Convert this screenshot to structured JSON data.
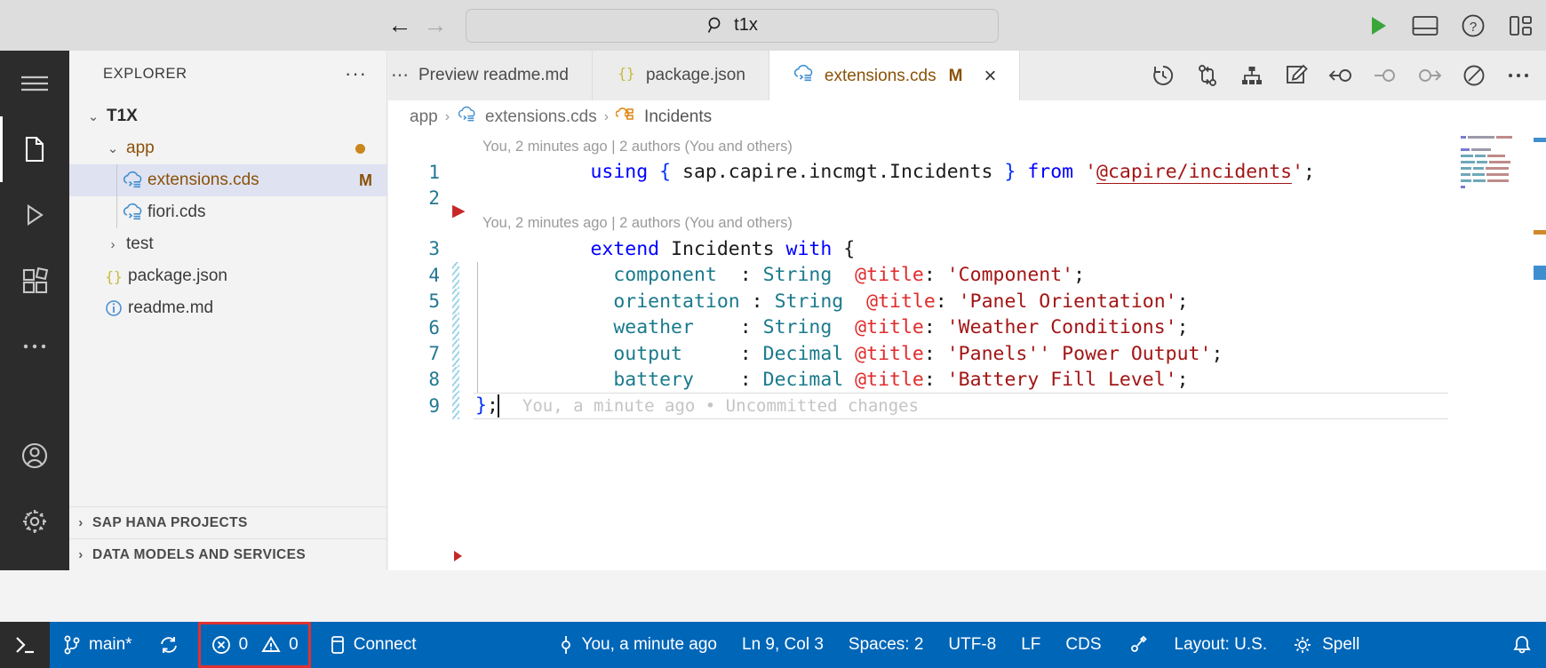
{
  "titlebar": {
    "back_icon": "arrow-left-icon",
    "forward_icon": "arrow-right-icon",
    "search_value": "t1x",
    "search_icon": "search-icon",
    "actions": [
      {
        "name": "run-project-button",
        "icon": "play-icon",
        "color": "#3aa63a"
      },
      {
        "name": "toggle-panel-button",
        "icon": "panel-layout-icon"
      },
      {
        "name": "help-button",
        "icon": "question-circle-icon"
      },
      {
        "name": "customize-layout-button",
        "icon": "customize-layout-icon"
      }
    ]
  },
  "activitybar": {
    "items": [
      {
        "name": "menu-button",
        "icon": "hamburger-icon",
        "active": false
      },
      {
        "name": "explorer-button",
        "icon": "files-icon",
        "active": true
      },
      {
        "name": "run-debug-button",
        "icon": "run-debug-icon",
        "active": false
      },
      {
        "name": "extensions-button",
        "icon": "extensions-icon",
        "active": false
      },
      {
        "name": "more-views-button",
        "icon": "ellipsis-icon",
        "active": false
      },
      {
        "name": "accounts-button",
        "icon": "account-icon",
        "active": false
      },
      {
        "name": "settings-button",
        "icon": "gear-icon",
        "active": false
      }
    ]
  },
  "sidebar": {
    "title": "EXPLORER",
    "more_actions": "···",
    "tree": [
      {
        "name": "tree-item-t1x",
        "label": "T1X",
        "chevron": "⌄",
        "expanded": true,
        "depth": 0,
        "style": "bold",
        "icon": "",
        "badge": ""
      },
      {
        "name": "tree-item-app",
        "label": "app",
        "chevron": "⌄",
        "expanded": true,
        "depth": 1,
        "style": "mod",
        "icon": "",
        "badge": "dot"
      },
      {
        "name": "tree-item-extensions-cds",
        "label": "extensions.cds",
        "chevron": "",
        "expanded": false,
        "depth": 2,
        "style": "mod",
        "icon": "cds-icon",
        "badge": "M",
        "selected": true
      },
      {
        "name": "tree-item-fiori-cds",
        "label": "fiori.cds",
        "chevron": "",
        "expanded": false,
        "depth": 2,
        "style": "",
        "icon": "cds-icon",
        "badge": ""
      },
      {
        "name": "tree-item-test",
        "label": "test",
        "chevron": "›",
        "expanded": false,
        "depth": 1,
        "style": "",
        "icon": "",
        "badge": ""
      },
      {
        "name": "tree-item-package-json",
        "label": "package.json",
        "chevron": "",
        "expanded": false,
        "depth": 1,
        "style": "",
        "icon": "json-icon",
        "badge": ""
      },
      {
        "name": "tree-item-readme-md",
        "label": "readme.md",
        "chevron": "",
        "expanded": false,
        "depth": 1,
        "style": "",
        "icon": "info-icon",
        "badge": ""
      }
    ],
    "sections": [
      {
        "name": "sidebar-section-sap-hana-projects",
        "label": "SAP HANA PROJECTS",
        "chevron": "›"
      },
      {
        "name": "sidebar-section-data-models-and-services",
        "label": "DATA MODELS AND SERVICES",
        "chevron": "›"
      }
    ]
  },
  "editor": {
    "tabs": [
      {
        "name": "tab-preview-readme-md",
        "label": "Preview readme.md",
        "icon": "",
        "modified": "",
        "active": false,
        "clipped": true
      },
      {
        "name": "tab-package-json",
        "label": "package.json",
        "icon": "json-icon",
        "modified": "",
        "active": false
      },
      {
        "name": "tab-extensions-cds",
        "label": "extensions.cds",
        "icon": "cds-icon",
        "modified": "M",
        "active": true,
        "close": "×"
      }
    ],
    "tab_actions": [
      {
        "name": "timeline-history-button",
        "icon": "history-clock-icon"
      },
      {
        "name": "git-compare-button",
        "icon": "git-compare-icon"
      },
      {
        "name": "graph-hierarchy-button",
        "icon": "hierarchy-icon"
      },
      {
        "name": "edit-note-button",
        "icon": "edit-note-icon"
      },
      {
        "name": "go-to-previous-button",
        "icon": "arrow-circle-left-icon"
      },
      {
        "name": "circle-node-button",
        "icon": "circle-node-icon"
      },
      {
        "name": "go-to-next-button",
        "icon": "arrow-circle-right-icon"
      },
      {
        "name": "preview-graph-button",
        "icon": "pie-graph-icon"
      },
      {
        "name": "more-actions-button",
        "icon": "ellipsis-icon"
      }
    ],
    "breadcrumb": [
      {
        "name": "breadcrumb-app",
        "label": "app",
        "icon": ""
      },
      {
        "name": "breadcrumb-extensions-cds",
        "label": "extensions.cds",
        "icon": "cds-icon"
      },
      {
        "name": "breadcrumb-incidents",
        "label": "Incidents",
        "icon": "entity-icon"
      }
    ],
    "breadcrumb_separator": "›",
    "blame_top": "You, 2 minutes ago | 2 authors (You and others)",
    "blame_mid": "You, 2 minutes ago | 2 authors (You and others)",
    "inline_blame": "You, a minute ago • Uncommitted changes",
    "lines": [
      {
        "num": "1",
        "tokens": [
          {
            "t": "using ",
            "c": "t-kw"
          },
          {
            "t": "{ ",
            "c": "t-brace"
          },
          {
            "t": "sap.capire.incmgt.Incidents",
            "c": "t-ident"
          },
          {
            "t": " }",
            "c": "t-brace"
          },
          {
            "t": " from ",
            "c": "t-kw"
          },
          {
            "t": "'",
            "c": "t-str"
          },
          {
            "t": "@capire/incidents",
            "c": "t-link"
          },
          {
            "t": "'",
            "c": "t-str"
          },
          {
            "t": ";",
            "c": "t-punc"
          }
        ],
        "diff": false
      },
      {
        "num": "2",
        "tokens": [],
        "diff": false
      },
      {
        "num": "3",
        "tokens": [
          {
            "t": "extend ",
            "c": "t-kw"
          },
          {
            "t": "Incidents",
            "c": "t-ident"
          },
          {
            "t": " with ",
            "c": "t-kw"
          },
          {
            "t": "{",
            "c": "t-punc"
          }
        ],
        "diff": false
      },
      {
        "num": "4",
        "tokens": [
          {
            "t": "  component  ",
            "c": "t-prop"
          },
          {
            "t": ": ",
            "c": "t-punc"
          },
          {
            "t": "String ",
            "c": "t-type"
          },
          {
            "t": " @title",
            "c": "t-anno"
          },
          {
            "t": ": ",
            "c": "t-punc"
          },
          {
            "t": "'Component'",
            "c": "t-str"
          },
          {
            "t": ";",
            "c": "t-punc"
          }
        ],
        "diff": true
      },
      {
        "num": "5",
        "tokens": [
          {
            "t": "  orientation",
            "c": "t-prop"
          },
          {
            "t": " : ",
            "c": "t-punc"
          },
          {
            "t": "String ",
            "c": "t-type"
          },
          {
            "t": " @title",
            "c": "t-anno"
          },
          {
            "t": ": ",
            "c": "t-punc"
          },
          {
            "t": "'Panel Orientation'",
            "c": "t-str"
          },
          {
            "t": ";",
            "c": "t-punc"
          }
        ],
        "diff": true
      },
      {
        "num": "6",
        "tokens": [
          {
            "t": "  weather    ",
            "c": "t-prop"
          },
          {
            "t": ": ",
            "c": "t-punc"
          },
          {
            "t": "String ",
            "c": "t-type"
          },
          {
            "t": " @title",
            "c": "t-anno"
          },
          {
            "t": ": ",
            "c": "t-punc"
          },
          {
            "t": "'Weather Conditions'",
            "c": "t-str"
          },
          {
            "t": ";",
            "c": "t-punc"
          }
        ],
        "diff": true
      },
      {
        "num": "7",
        "tokens": [
          {
            "t": "  output     ",
            "c": "t-prop"
          },
          {
            "t": ": ",
            "c": "t-punc"
          },
          {
            "t": "Decimal",
            "c": "t-type"
          },
          {
            "t": " @title",
            "c": "t-anno"
          },
          {
            "t": ": ",
            "c": "t-punc"
          },
          {
            "t": "'Panels'' Power Output'",
            "c": "t-str"
          },
          {
            "t": ";",
            "c": "t-punc"
          }
        ],
        "diff": true
      },
      {
        "num": "8",
        "tokens": [
          {
            "t": "  battery    ",
            "c": "t-prop"
          },
          {
            "t": ": ",
            "c": "t-punc"
          },
          {
            "t": "Decimal",
            "c": "t-type"
          },
          {
            "t": " @title",
            "c": "t-anno"
          },
          {
            "t": ": ",
            "c": "t-punc"
          },
          {
            "t": "'Battery Fill Level'",
            "c": "t-str"
          },
          {
            "t": ";",
            "c": "t-punc"
          }
        ],
        "diff": true
      },
      {
        "num": "9",
        "tokens": [
          {
            "t": "}",
            "c": "t-brace"
          },
          {
            "t": ";",
            "c": "t-punc"
          }
        ],
        "diff": true,
        "current": true
      }
    ]
  },
  "statusbar": {
    "remote_icon": "remote-window-icon",
    "branch": "main*",
    "branch_icon": "source-control-icon",
    "sync_icon": "sync-icon",
    "errors": "0",
    "warnings": "0",
    "error_icon": "error-circle-icon",
    "warning_icon": "warning-triangle-icon",
    "connect_label": "Connect",
    "connect_icon": "database-icon",
    "blame_label": "You, a minute ago",
    "blame_icon": "git-commit-icon",
    "position": "Ln 9, Col 3",
    "indentation": "Spaces: 2",
    "encoding": "UTF-8",
    "eol": "LF",
    "language": "CDS",
    "screencast_icon": "screencast-icon",
    "keyboard_layout": "Layout: U.S.",
    "spell_label": "Spell",
    "spell_icon": "spell-check-icon",
    "bell_icon": "bell-icon",
    "accent_color": "#0066b8",
    "highlight_box_color": "#e03131"
  }
}
